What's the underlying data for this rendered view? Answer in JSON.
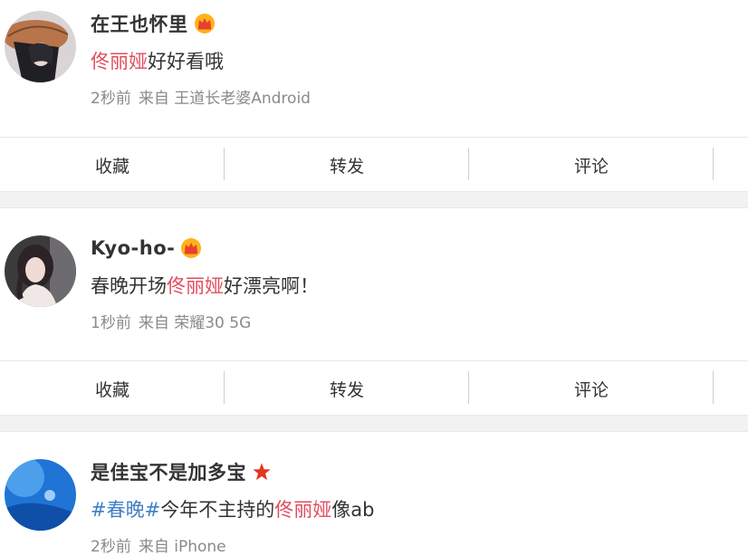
{
  "posts": [
    {
      "username": "在王也怀里",
      "badge": "crown-icon",
      "content": [
        {
          "text": "佟丽娅",
          "style": "highlight"
        },
        {
          "text": "好好看哦",
          "style": "plain"
        }
      ],
      "time": "2秒前",
      "source": "来自 王道长老婆Android",
      "actions": [
        "收藏",
        "转发",
        "评论"
      ]
    },
    {
      "username": "Kyo-ho-",
      "badge": "crown-icon",
      "content": [
        {
          "text": "春晚开场",
          "style": "plain"
        },
        {
          "text": "佟丽娅",
          "style": "highlight"
        },
        {
          "text": "好漂亮啊！",
          "style": "plain"
        }
      ],
      "time": "1秒前",
      "source": "来自 荣耀30 5G",
      "actions": [
        "收藏",
        "转发",
        "评论"
      ]
    },
    {
      "username": "是佳宝不是加多宝",
      "badge": "star-icon",
      "content": [
        {
          "text": "#春晚#",
          "style": "tag"
        },
        {
          "text": "今年不主持的",
          "style": "plain"
        },
        {
          "text": "佟丽娅",
          "style": "highlight"
        },
        {
          "text": "像ab",
          "style": "plain"
        }
      ],
      "time": "2秒前",
      "source": "来自 iPhone"
    }
  ],
  "colors": {
    "highlight": "#e24e60",
    "tag": "#3f7fc6",
    "meta": "#8a8a8a",
    "separator_band": "#f2f2f2"
  }
}
